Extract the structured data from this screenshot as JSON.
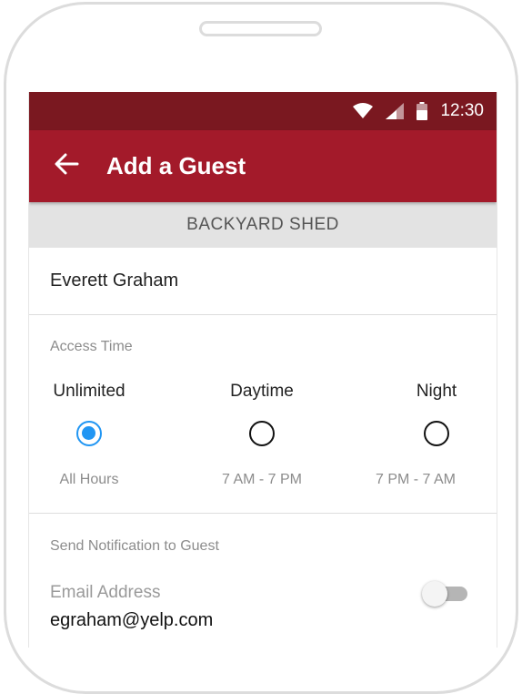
{
  "status_bar": {
    "time": "12:30",
    "icons": [
      "wifi-icon",
      "cell-signal-icon",
      "battery-icon"
    ]
  },
  "app_bar": {
    "title": "Add a Guest",
    "back_icon": "arrow-left-icon"
  },
  "lock": {
    "name": "BACKYARD SHED"
  },
  "guest": {
    "name": "Everett Graham"
  },
  "access_time": {
    "label": "Access Time",
    "options": [
      {
        "label": "Unlimited",
        "sub": "All Hours",
        "selected": true
      },
      {
        "label": "Daytime",
        "sub": "7 AM - 7 PM",
        "selected": false
      },
      {
        "label": "Night",
        "sub": "7 PM - 7 AM",
        "selected": false
      }
    ]
  },
  "notification": {
    "label": "Send Notification to Guest",
    "email_label": "Email Address",
    "email_value": "egraham@yelp.com",
    "email_enabled": false
  },
  "colors": {
    "status_bar": "#7a1820",
    "app_bar": "#a31a2a",
    "radio_selected": "#2196f3",
    "section_header": "#e3e3e3"
  }
}
